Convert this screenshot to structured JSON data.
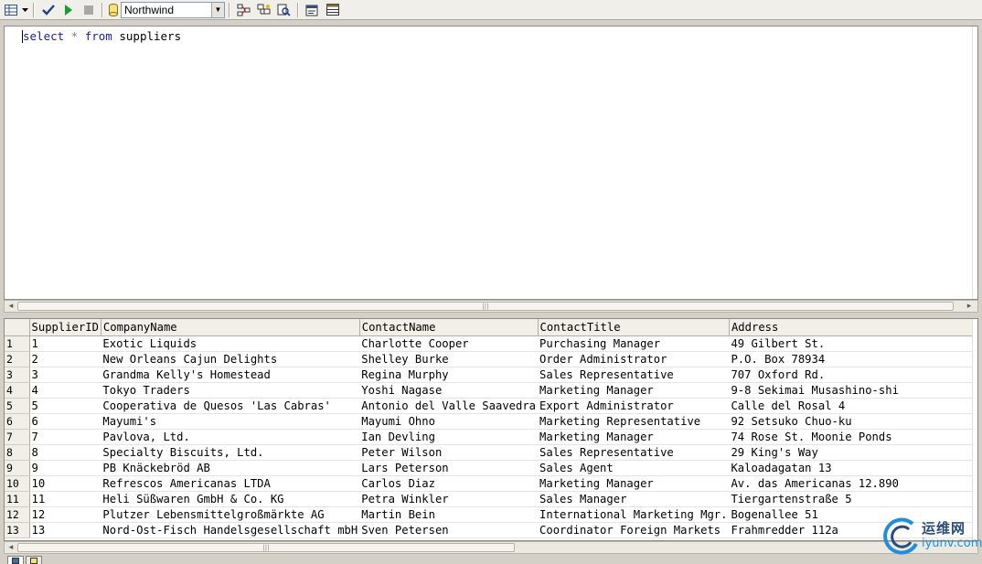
{
  "toolbar": {
    "database": "Northwind",
    "icons": [
      "grid-view-icon",
      "dropdown-arrow-icon",
      "parse-check-icon",
      "execute-play-icon",
      "cancel-stop-icon",
      "database-cylinder-icon",
      "estimated-plan-icon",
      "object-search-icon",
      "find-icon",
      "properties-icon",
      "results-grid-icon"
    ]
  },
  "editor": {
    "query_keyword_select": "select",
    "query_star": " * ",
    "query_keyword_from": "from",
    "query_table": " suppliers"
  },
  "grid": {
    "columns": [
      "SupplierID",
      "CompanyName",
      "ContactName",
      "ContactTitle",
      "Address"
    ],
    "rows": [
      {
        "num": "1",
        "cells": [
          "1",
          "Exotic Liquids",
          "Charlotte Cooper",
          "Purchasing Manager",
          "49 Gilbert St."
        ]
      },
      {
        "num": "2",
        "cells": [
          "2",
          "New Orleans Cajun Delights",
          "Shelley Burke",
          "Order Administrator",
          "P.O. Box 78934"
        ]
      },
      {
        "num": "3",
        "cells": [
          "3",
          "Grandma Kelly's Homestead",
          "Regina Murphy",
          "Sales Representative",
          "707 Oxford Rd."
        ]
      },
      {
        "num": "4",
        "cells": [
          "4",
          "Tokyo Traders",
          "Yoshi Nagase",
          "Marketing Manager",
          "9-8 Sekimai Musashino-shi"
        ]
      },
      {
        "num": "5",
        "cells": [
          "5",
          "Cooperativa de Quesos 'Las Cabras'",
          "Antonio del Valle Saavedra",
          "Export Administrator",
          "Calle del Rosal 4"
        ]
      },
      {
        "num": "6",
        "cells": [
          "6",
          "Mayumi's",
          "Mayumi Ohno",
          "Marketing Representative",
          "92 Setsuko Chuo-ku"
        ]
      },
      {
        "num": "7",
        "cells": [
          "7",
          "Pavlova, Ltd.",
          "Ian Devling",
          "Marketing Manager",
          "74 Rose St. Moonie Ponds"
        ]
      },
      {
        "num": "8",
        "cells": [
          "8",
          "Specialty Biscuits, Ltd.",
          "Peter Wilson",
          "Sales Representative",
          "29 King's Way"
        ]
      },
      {
        "num": "9",
        "cells": [
          "9",
          "PB Knäckebröd AB",
          "Lars Peterson",
          "Sales Agent",
          "Kaloadagatan 13"
        ]
      },
      {
        "num": "10",
        "cells": [
          "10",
          "Refrescos Americanas LTDA",
          "Carlos Diaz",
          "Marketing Manager",
          "Av. das Americanas 12.890"
        ]
      },
      {
        "num": "11",
        "cells": [
          "11",
          "Heli Süßwaren GmbH & Co. KG",
          "Petra Winkler",
          "Sales Manager",
          "Tiergartenstraße 5"
        ]
      },
      {
        "num": "12",
        "cells": [
          "12",
          "Plutzer Lebensmittelgroßmärkte AG",
          "Martin Bein",
          "International Marketing Mgr.",
          "Bogenallee 51"
        ]
      },
      {
        "num": "13",
        "cells": [
          "13",
          "Nord-Ost-Fisch Handelsgesellschaft mbH",
          "Sven Petersen",
          "Coordinator Foreign Markets",
          "Frahmredder 112a"
        ]
      }
    ]
  },
  "watermark": {
    "cn": "运维网",
    "en": "iyunv.com"
  }
}
